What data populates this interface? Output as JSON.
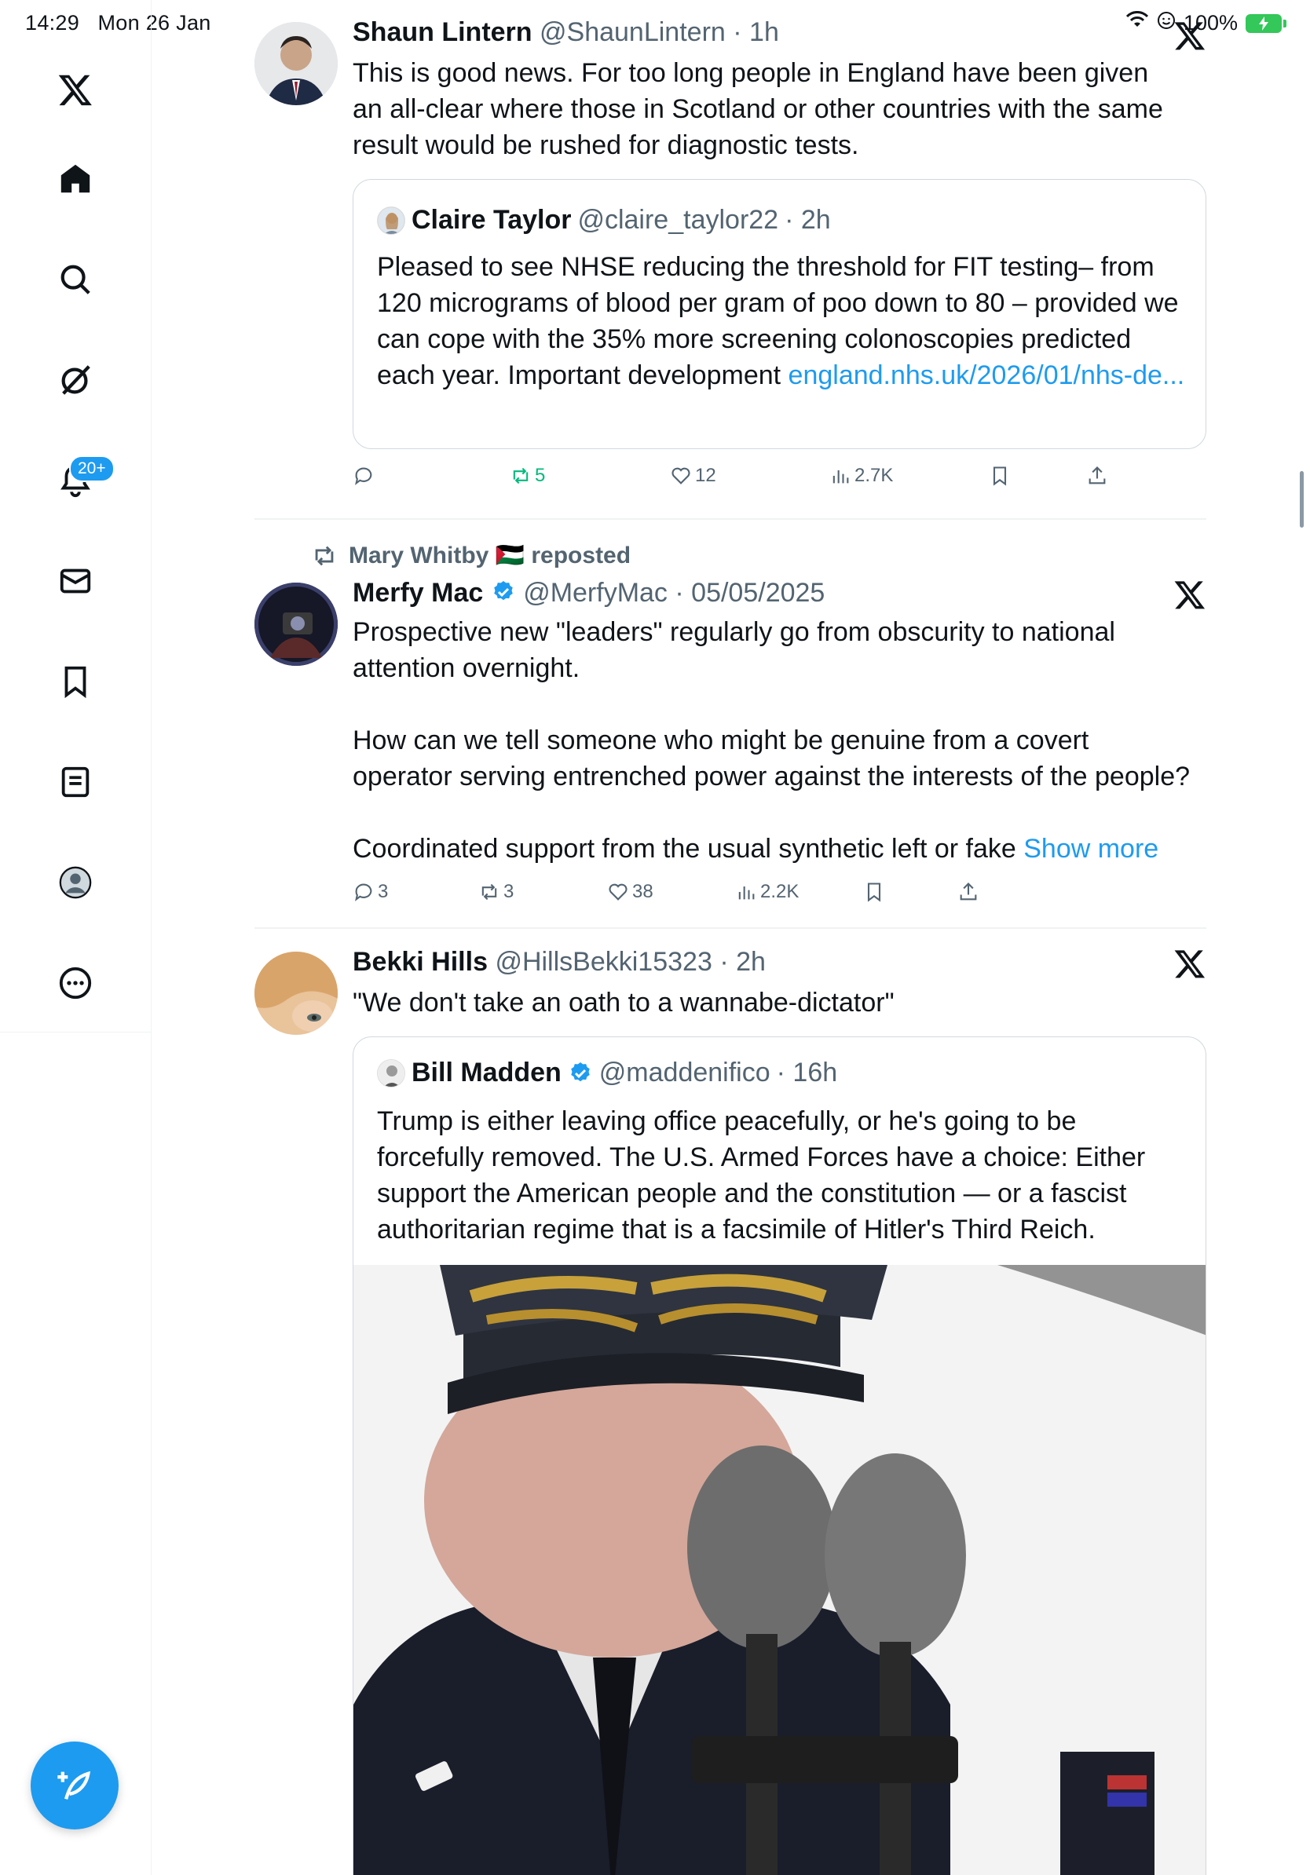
{
  "status_bar": {
    "time": "14:29",
    "date": "Mon 26 Jan",
    "battery": "100%"
  },
  "sidebar": {
    "items": [
      {
        "name": "x-logo-icon"
      },
      {
        "name": "home-icon"
      },
      {
        "name": "search-icon"
      },
      {
        "name": "grok-icon"
      },
      {
        "name": "notifications-icon"
      },
      {
        "name": "messages-icon"
      },
      {
        "name": "bookmarks-icon"
      },
      {
        "name": "lists-icon"
      },
      {
        "name": "profile-icon"
      },
      {
        "name": "more-icon"
      }
    ],
    "notif_badge": "20+",
    "compose_icon": "compose-feather-icon"
  },
  "colors": {
    "accent": "#1d9bf0",
    "text": "#0f1419",
    "muted": "#536471",
    "retweet_green": "#00ba7c",
    "border": "#cfd9de"
  },
  "tweets": [
    {
      "name": "Shaun Lintern",
      "handle": "@ShaunLintern",
      "time": "· 1h",
      "text": "This is good news. For too long people in England have been given an all-clear where those in Scotland or other countries with the same result would be rushed for diagnostic tests.",
      "quote": {
        "name": "Claire Taylor",
        "handle": "@claire_taylor22",
        "time": "· 2h",
        "text": "Pleased to see NHSE reducing the threshold for FIT testing– from 120 micrograms of blood per gram of poo down to 80 – provided we can cope with the 35% more screening colonoscopies predicted each year. Important development ",
        "link": "england.nhs.uk/2026/01/nhs-de..."
      },
      "actions": {
        "replies": "",
        "reposts": "5",
        "likes": "12",
        "views": "2.7K"
      }
    },
    {
      "repost_by": "Mary Whitby 🇵🇸 reposted",
      "name": "Merfy Mac",
      "handle": "@MerfyMac",
      "time": "· 05/05/2025",
      "text_1": "Prospective new \"leaders\" regularly go from obscurity to national attention overnight.",
      "text_2": "How can we tell someone who might be genuine from a covert operator serving entrenched power against the interests of the people?",
      "text_3": "Coordinated support from the usual synthetic left or fake ",
      "show_more": "Show more",
      "actions": {
        "replies": "3",
        "reposts": "3",
        "likes": "38",
        "views": "2.2K"
      }
    },
    {
      "name": "Bekki Hills",
      "handle": "@HillsBekki15323",
      "time": "· 2h",
      "text": "\"We don't take an oath to a wannabe-dictator\"",
      "quote": {
        "name": "Bill Madden",
        "handle": "@maddenifico",
        "time": "· 16h",
        "text": "Trump is either leaving office peacefully, or he's going to be forcefully removed. The U.S. Armed Forces have a choice: Either support the American people and the constitution — or a fascist authoritarian regime that is a facsimile of Hitler's Third Reich."
      }
    }
  ]
}
